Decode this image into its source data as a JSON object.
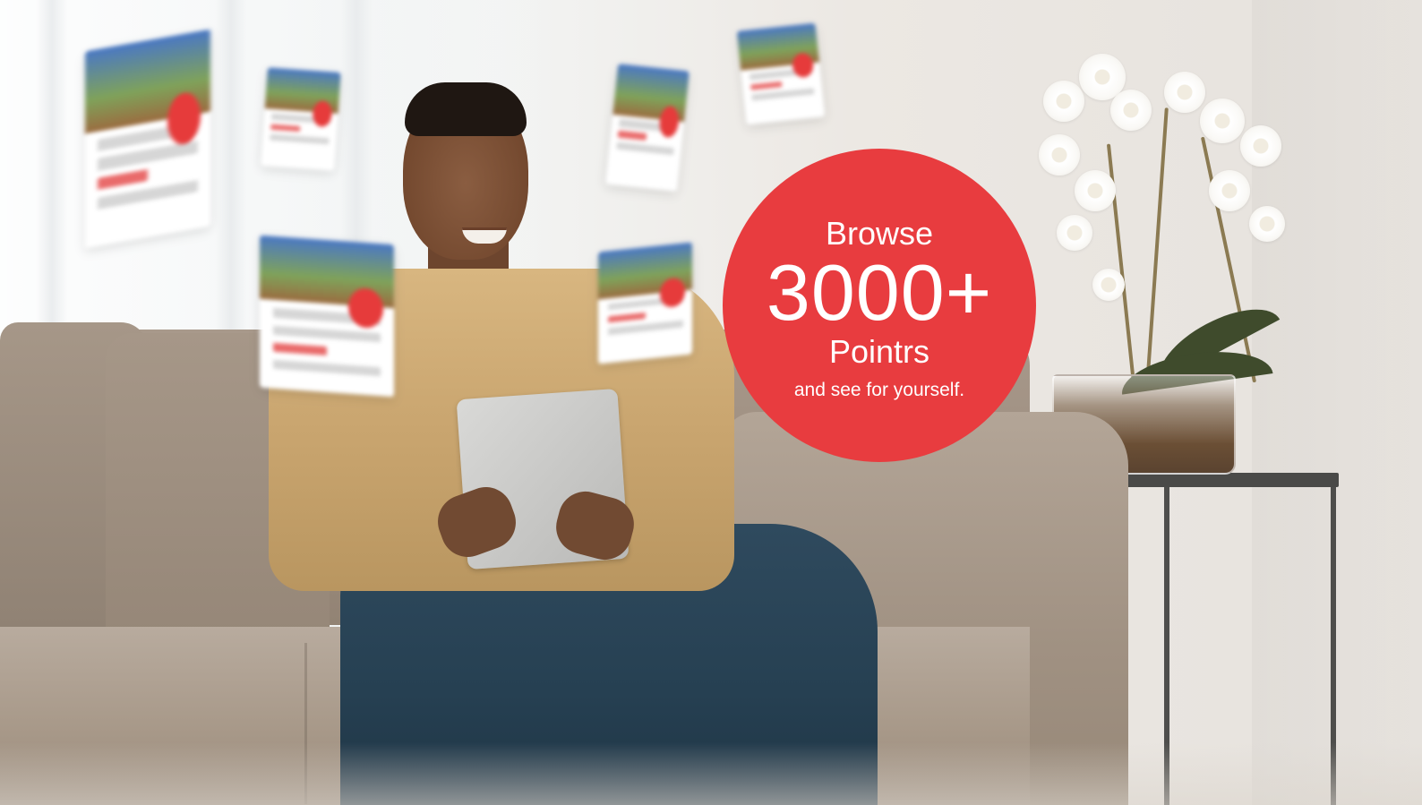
{
  "badge": {
    "line1": "Browse",
    "count": "3000+",
    "line3": "Pointrs",
    "tagline": "and see for yourself.",
    "color": "#e83c3f"
  },
  "scene": {
    "subject": "man-on-sofa-with-tablet"
  }
}
